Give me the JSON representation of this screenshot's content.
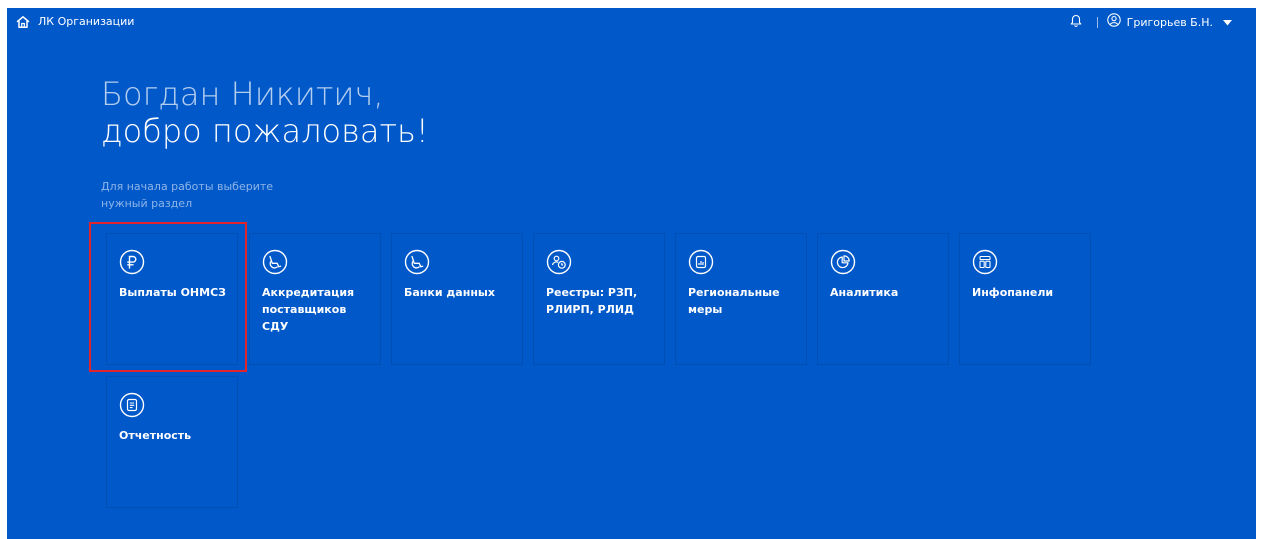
{
  "header": {
    "home_label": "ЛК Организации",
    "user_name": "Григорьев Б.Н."
  },
  "greeting": {
    "line1": "Богдан Никитич,",
    "line2": "добро пожаловать!"
  },
  "hint": "Для начала работы выберите нужный раздел",
  "tiles": [
    {
      "label": "Выплаты ОНМСЗ",
      "icon": "ruble-icon"
    },
    {
      "label": "Аккредитация поставщиков СДУ",
      "icon": "wheelchair-icon"
    },
    {
      "label": "Банки данных",
      "icon": "wheelchair-icon"
    },
    {
      "label": "Реестры: РЗП, РЛИРП, РЛИД",
      "icon": "users-clock-icon"
    },
    {
      "label": "Региональные меры",
      "icon": "document-chart-icon"
    },
    {
      "label": "Аналитика",
      "icon": "pie-chart-icon"
    },
    {
      "label": "Инфопанели",
      "icon": "dashboard-icon"
    },
    {
      "label": "Отчетность",
      "icon": "document-icon"
    }
  ],
  "colors": {
    "background": "#0058c9",
    "highlight": "#e3232c"
  }
}
